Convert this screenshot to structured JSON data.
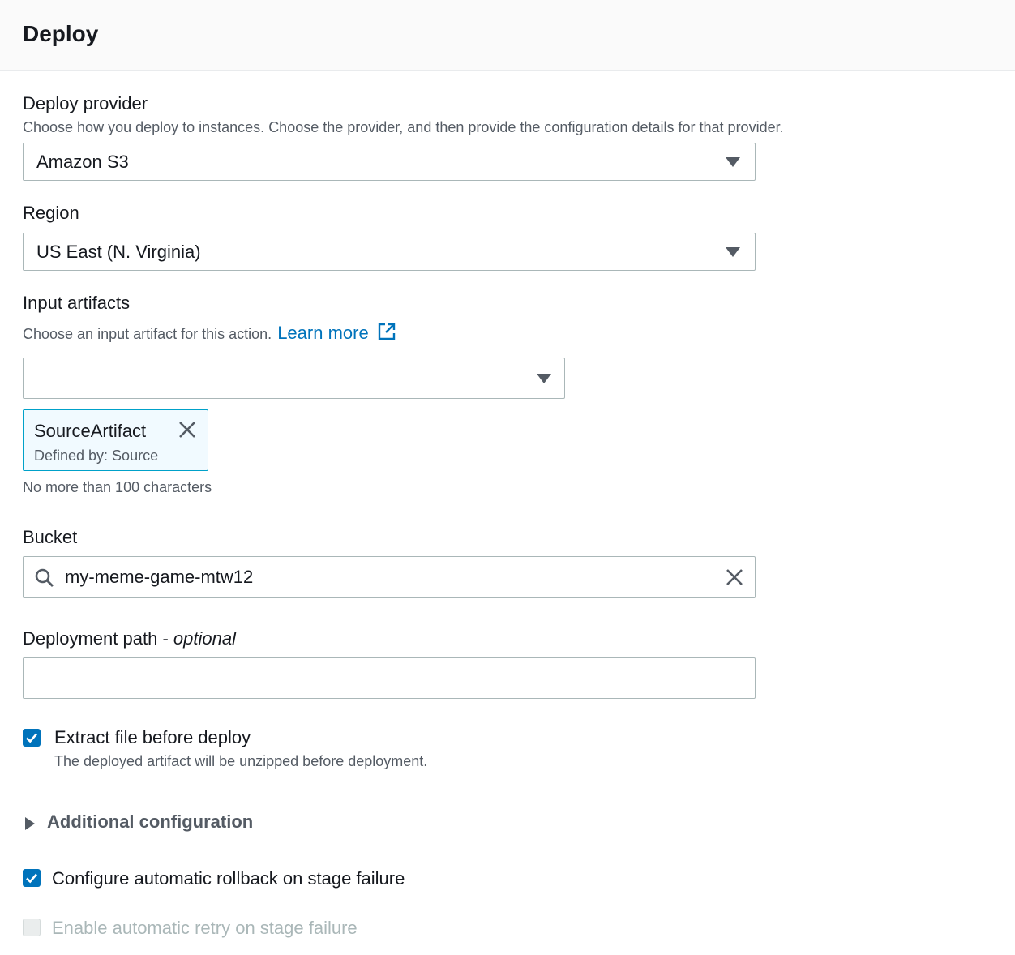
{
  "header": {
    "title": "Deploy"
  },
  "deploy_provider": {
    "label": "Deploy provider",
    "description": "Choose how you deploy to instances. Choose the provider, and then provide the configuration details for that provider.",
    "value": "Amazon S3"
  },
  "region": {
    "label": "Region",
    "value": "US East (N. Virginia)"
  },
  "input_artifacts": {
    "label": "Input artifacts",
    "description": "Choose an input artifact for this action.",
    "learn_more": "Learn more",
    "select_value": "",
    "token": {
      "name": "SourceArtifact",
      "subtitle": "Defined by: Source"
    },
    "constraint": "No more than 100 characters"
  },
  "bucket": {
    "label": "Bucket",
    "value": "my-meme-game-mtw12"
  },
  "deployment_path": {
    "label": "Deployment path",
    "separator": " - ",
    "optional": "optional",
    "value": ""
  },
  "extract_file": {
    "label": "Extract file before deploy",
    "description": "The deployed artifact will be unzipped before deployment.",
    "checked": true
  },
  "additional_configuration": {
    "label": "Additional configuration",
    "expanded": false
  },
  "rollback": {
    "label": "Configure automatic rollback on stage failure",
    "checked": true
  },
  "retry": {
    "label": "Enable automatic retry on stage failure",
    "checked": false,
    "disabled": true
  },
  "colors": {
    "accent": "#0073bb",
    "border": "#aab7b8",
    "token_border": "#00a1c9",
    "token_bg": "#f1faff"
  }
}
